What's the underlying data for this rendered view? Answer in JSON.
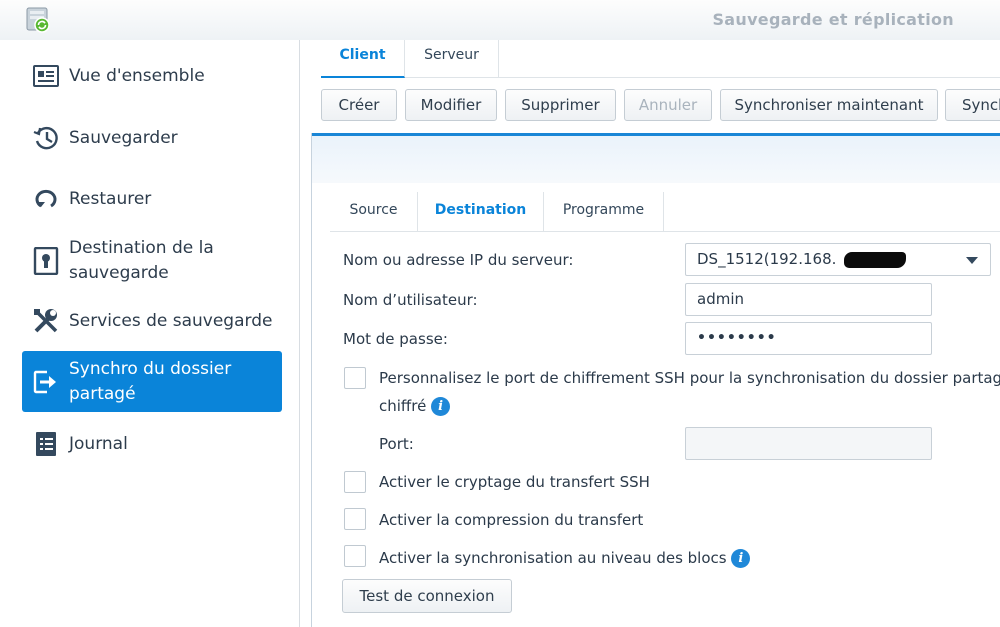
{
  "window": {
    "title": "Sauvegarde et réplication",
    "app_icon": "backup-app-icon"
  },
  "sidebar": {
    "items": [
      {
        "label": "Vue d'ensemble",
        "icon": "overview-card-icon"
      },
      {
        "label": "Sauvegarder",
        "icon": "history-clock-icon"
      },
      {
        "label": "Restaurer",
        "icon": "restore-arrow-icon"
      },
      {
        "label": "Destination de la sauvegarde",
        "icon": "destination-lock-icon"
      },
      {
        "label": "Services de sauvegarde",
        "icon": "tools-icon"
      },
      {
        "label": "Synchro du dossier partagé",
        "icon": "sync-folder-icon",
        "active": true
      },
      {
        "label": "Journal",
        "icon": "log-list-icon"
      }
    ],
    "accent": "#0a84d9"
  },
  "top_tabs": [
    {
      "label": "Client",
      "active": true
    },
    {
      "label": "Serveur",
      "active": false
    }
  ],
  "toolbar": {
    "create": "Créer",
    "modify": "Modifier",
    "delete": "Supprimer",
    "cancel": "Annuler",
    "sync_now": "Synchroniser maintenant",
    "sync_more": "Synch"
  },
  "dialog": {
    "tabs": [
      {
        "label": "Source",
        "active": false
      },
      {
        "label": "Destination",
        "active": true
      },
      {
        "label": "Programme",
        "active": false
      }
    ],
    "server_label": "Nom ou adresse IP du serveur:",
    "server_value": "DS_1512(192.168.",
    "username_label": "Nom d’utilisateur:",
    "username_value": "admin",
    "password_label": "Mot de passe:",
    "password_value": "••••••••",
    "ssh_port_option_line1": "Personnalisez le port de chiffrement SSH pour la synchronisation du dossier partagé",
    "ssh_port_option_line2": "chiffré",
    "port_label": "Port:",
    "port_value": "",
    "ssh_encrypt_option": "Activer le cryptage du transfert SSH",
    "compression_option": "Activer la compression du transfert",
    "block_sync_option": "Activer la synchronisation au niveau des blocs",
    "test_button": "Test de connexion",
    "info_glyph": "i"
  }
}
